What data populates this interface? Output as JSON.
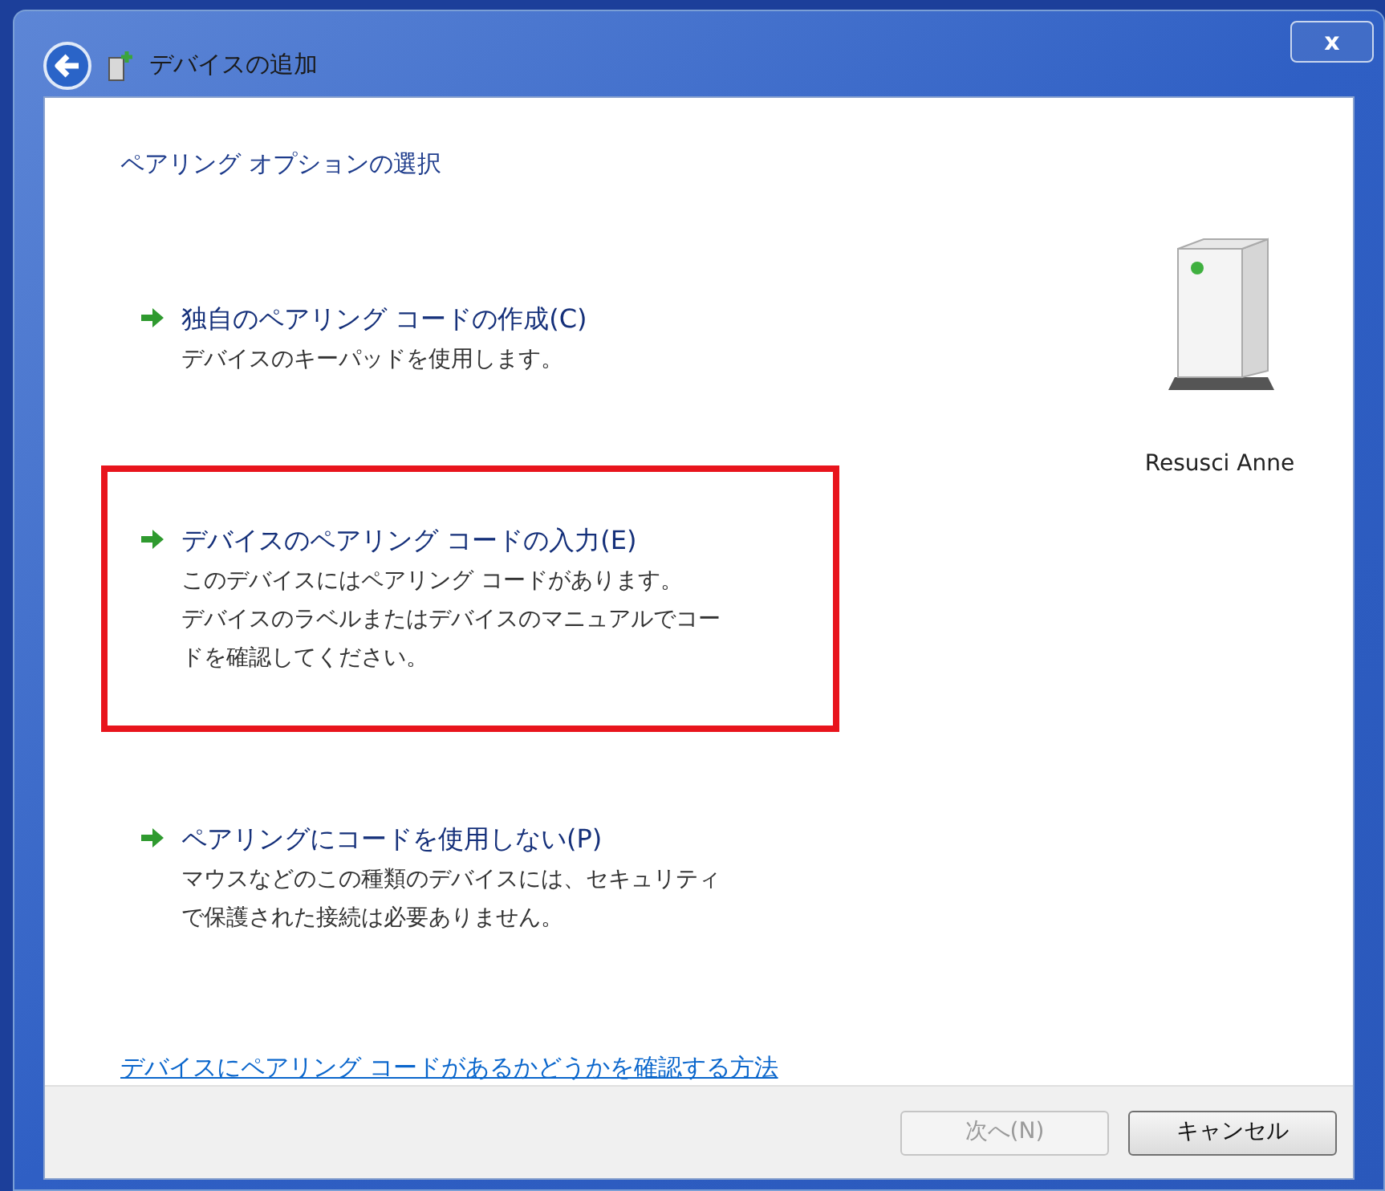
{
  "window": {
    "title": "デバイスの追加",
    "close": "x"
  },
  "heading": "ペアリング オプションの選択",
  "options": [
    {
      "title": "独自のペアリング コードの作成(C)",
      "description_lines": [
        "デバイスのキーパッドを使用します。"
      ],
      "highlighted": false
    },
    {
      "title": "デバイスのペアリング コードの入力(E)",
      "description_lines": [
        "このデバイスにはペアリング コードがあります。",
        "デバイスのラベルまたはデバイスのマニュアルでコー",
        "ドを確認してください。"
      ],
      "highlighted": true
    },
    {
      "title": "ペアリングにコードを使用しない(P)",
      "description_lines": [
        "マウスなどのこの種類のデバイスには、セキュリティ",
        "で保護された接続は必要ありません。"
      ],
      "highlighted": false
    }
  ],
  "device": {
    "name": "Resusci Anne"
  },
  "help_link": "デバイスにペアリング コードがあるかどうかを確認する方法",
  "buttons": [
    {
      "label": "次へ(N)",
      "disabled": true
    },
    {
      "label": "キャンセル",
      "disabled": false
    }
  ]
}
